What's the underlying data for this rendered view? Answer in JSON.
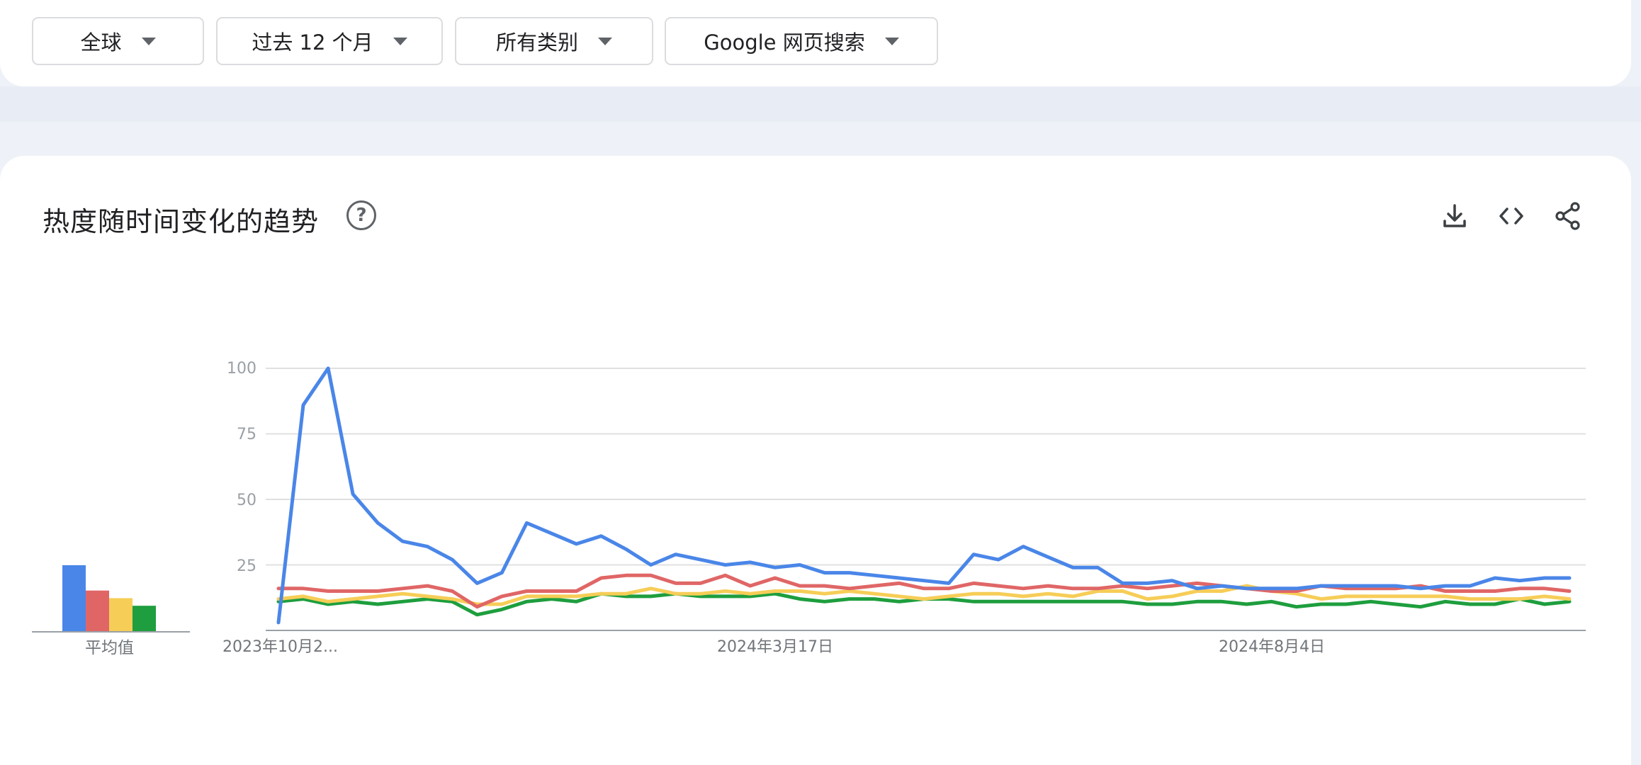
{
  "filters": {
    "region": "全球",
    "time": "过去 12 个月",
    "category": "所有类别",
    "search_type": "Google 网页搜索"
  },
  "section": {
    "title": "热度随时间变化的趋势",
    "help_glyph": "?"
  },
  "icons": [
    "download-icon",
    "embed-code-icon",
    "share-icon"
  ],
  "chart_data": {
    "type": "line",
    "ylim": [
      0,
      100
    ],
    "yticks": [
      "100",
      "75",
      "50",
      "25"
    ],
    "xtick_labels": [
      "2023年10月2...",
      "2024年3月17日",
      "2024年8月4日"
    ],
    "average_label": "平均值",
    "colors": [
      "#4a86e8",
      "#e06666",
      "#f6cd57",
      "#1e9e3e"
    ],
    "averages": [
      26,
      16,
      13,
      10
    ],
    "series": [
      {
        "color": "#4a86e8",
        "values": [
          3,
          86,
          100,
          52,
          41,
          34,
          32,
          27,
          18,
          22,
          41,
          37,
          33,
          36,
          31,
          25,
          29,
          27,
          25,
          26,
          24,
          25,
          22,
          22,
          21,
          20,
          19,
          18,
          29,
          27,
          32,
          28,
          24,
          24,
          18,
          18,
          19,
          16,
          17,
          16,
          16,
          16,
          17,
          17,
          17,
          17,
          16,
          17,
          17,
          20,
          19,
          20,
          20
        ]
      },
      {
        "color": "#e06666",
        "values": [
          16,
          16,
          15,
          15,
          15,
          16,
          17,
          15,
          9,
          13,
          15,
          15,
          15,
          20,
          21,
          21,
          18,
          18,
          21,
          17,
          20,
          17,
          17,
          16,
          17,
          18,
          16,
          16,
          18,
          17,
          16,
          17,
          16,
          16,
          17,
          16,
          17,
          18,
          17,
          16,
          15,
          15,
          17,
          16,
          16,
          16,
          17,
          15,
          15,
          15,
          16,
          16,
          15
        ]
      },
      {
        "color": "#f6cd57",
        "values": [
          12,
          13,
          11,
          12,
          13,
          14,
          13,
          12,
          10,
          10,
          13,
          13,
          13,
          14,
          14,
          16,
          14,
          14,
          15,
          14,
          15,
          15,
          14,
          15,
          14,
          13,
          12,
          13,
          14,
          14,
          13,
          14,
          13,
          15,
          15,
          12,
          13,
          15,
          15,
          17,
          15,
          14,
          12,
          13,
          13,
          13,
          13,
          13,
          12,
          12,
          12,
          13,
          12
        ]
      },
      {
        "color": "#1e9e3e",
        "values": [
          11,
          12,
          10,
          11,
          10,
          11,
          12,
          11,
          6,
          8,
          11,
          12,
          11,
          14,
          13,
          13,
          14,
          13,
          13,
          13,
          14,
          12,
          11,
          12,
          12,
          11,
          12,
          12,
          11,
          11,
          11,
          11,
          11,
          11,
          11,
          10,
          10,
          11,
          11,
          10,
          11,
          9,
          10,
          10,
          11,
          10,
          9,
          11,
          10,
          10,
          12,
          10,
          11
        ]
      }
    ]
  }
}
